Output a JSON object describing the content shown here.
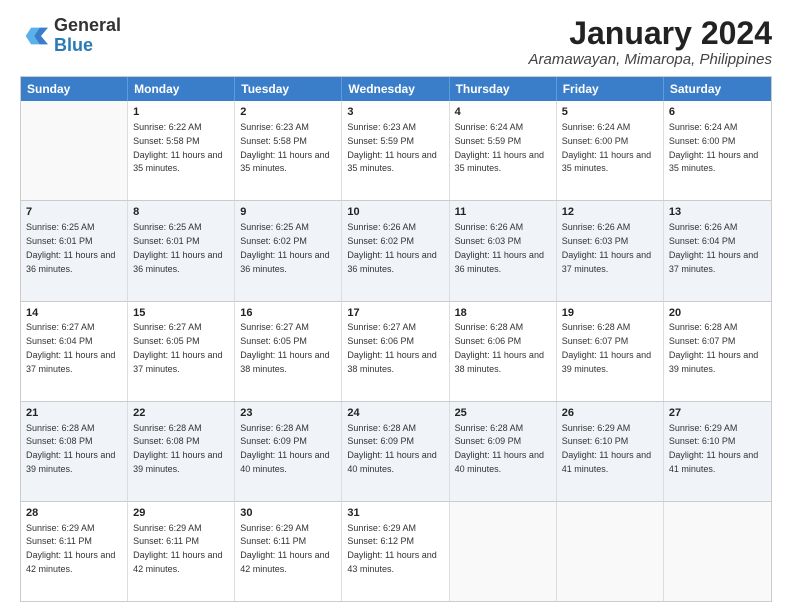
{
  "header": {
    "logo": {
      "general": "General",
      "blue": "Blue"
    },
    "title": "January 2024",
    "subtitle": "Aramawayan, Mimaropa, Philippines"
  },
  "calendar": {
    "days": [
      "Sunday",
      "Monday",
      "Tuesday",
      "Wednesday",
      "Thursday",
      "Friday",
      "Saturday"
    ],
    "weeks": [
      [
        {
          "day": "",
          "empty": true
        },
        {
          "day": "1",
          "sunrise": "Sunrise: 6:22 AM",
          "sunset": "Sunset: 5:58 PM",
          "daylight": "Daylight: 11 hours and 35 minutes."
        },
        {
          "day": "2",
          "sunrise": "Sunrise: 6:23 AM",
          "sunset": "Sunset: 5:58 PM",
          "daylight": "Daylight: 11 hours and 35 minutes."
        },
        {
          "day": "3",
          "sunrise": "Sunrise: 6:23 AM",
          "sunset": "Sunset: 5:59 PM",
          "daylight": "Daylight: 11 hours and 35 minutes."
        },
        {
          "day": "4",
          "sunrise": "Sunrise: 6:24 AM",
          "sunset": "Sunset: 5:59 PM",
          "daylight": "Daylight: 11 hours and 35 minutes."
        },
        {
          "day": "5",
          "sunrise": "Sunrise: 6:24 AM",
          "sunset": "Sunset: 6:00 PM",
          "daylight": "Daylight: 11 hours and 35 minutes."
        },
        {
          "day": "6",
          "sunrise": "Sunrise: 6:24 AM",
          "sunset": "Sunset: 6:00 PM",
          "daylight": "Daylight: 11 hours and 35 minutes."
        }
      ],
      [
        {
          "day": "7",
          "sunrise": "Sunrise: 6:25 AM",
          "sunset": "Sunset: 6:01 PM",
          "daylight": "Daylight: 11 hours and 36 minutes."
        },
        {
          "day": "8",
          "sunrise": "Sunrise: 6:25 AM",
          "sunset": "Sunset: 6:01 PM",
          "daylight": "Daylight: 11 hours and 36 minutes."
        },
        {
          "day": "9",
          "sunrise": "Sunrise: 6:25 AM",
          "sunset": "Sunset: 6:02 PM",
          "daylight": "Daylight: 11 hours and 36 minutes."
        },
        {
          "day": "10",
          "sunrise": "Sunrise: 6:26 AM",
          "sunset": "Sunset: 6:02 PM",
          "daylight": "Daylight: 11 hours and 36 minutes."
        },
        {
          "day": "11",
          "sunrise": "Sunrise: 6:26 AM",
          "sunset": "Sunset: 6:03 PM",
          "daylight": "Daylight: 11 hours and 36 minutes."
        },
        {
          "day": "12",
          "sunrise": "Sunrise: 6:26 AM",
          "sunset": "Sunset: 6:03 PM",
          "daylight": "Daylight: 11 hours and 37 minutes."
        },
        {
          "day": "13",
          "sunrise": "Sunrise: 6:26 AM",
          "sunset": "Sunset: 6:04 PM",
          "daylight": "Daylight: 11 hours and 37 minutes."
        }
      ],
      [
        {
          "day": "14",
          "sunrise": "Sunrise: 6:27 AM",
          "sunset": "Sunset: 6:04 PM",
          "daylight": "Daylight: 11 hours and 37 minutes."
        },
        {
          "day": "15",
          "sunrise": "Sunrise: 6:27 AM",
          "sunset": "Sunset: 6:05 PM",
          "daylight": "Daylight: 11 hours and 37 minutes."
        },
        {
          "day": "16",
          "sunrise": "Sunrise: 6:27 AM",
          "sunset": "Sunset: 6:05 PM",
          "daylight": "Daylight: 11 hours and 38 minutes."
        },
        {
          "day": "17",
          "sunrise": "Sunrise: 6:27 AM",
          "sunset": "Sunset: 6:06 PM",
          "daylight": "Daylight: 11 hours and 38 minutes."
        },
        {
          "day": "18",
          "sunrise": "Sunrise: 6:28 AM",
          "sunset": "Sunset: 6:06 PM",
          "daylight": "Daylight: 11 hours and 38 minutes."
        },
        {
          "day": "19",
          "sunrise": "Sunrise: 6:28 AM",
          "sunset": "Sunset: 6:07 PM",
          "daylight": "Daylight: 11 hours and 39 minutes."
        },
        {
          "day": "20",
          "sunrise": "Sunrise: 6:28 AM",
          "sunset": "Sunset: 6:07 PM",
          "daylight": "Daylight: 11 hours and 39 minutes."
        }
      ],
      [
        {
          "day": "21",
          "sunrise": "Sunrise: 6:28 AM",
          "sunset": "Sunset: 6:08 PM",
          "daylight": "Daylight: 11 hours and 39 minutes."
        },
        {
          "day": "22",
          "sunrise": "Sunrise: 6:28 AM",
          "sunset": "Sunset: 6:08 PM",
          "daylight": "Daylight: 11 hours and 39 minutes."
        },
        {
          "day": "23",
          "sunrise": "Sunrise: 6:28 AM",
          "sunset": "Sunset: 6:09 PM",
          "daylight": "Daylight: 11 hours and 40 minutes."
        },
        {
          "day": "24",
          "sunrise": "Sunrise: 6:28 AM",
          "sunset": "Sunset: 6:09 PM",
          "daylight": "Daylight: 11 hours and 40 minutes."
        },
        {
          "day": "25",
          "sunrise": "Sunrise: 6:28 AM",
          "sunset": "Sunset: 6:09 PM",
          "daylight": "Daylight: 11 hours and 40 minutes."
        },
        {
          "day": "26",
          "sunrise": "Sunrise: 6:29 AM",
          "sunset": "Sunset: 6:10 PM",
          "daylight": "Daylight: 11 hours and 41 minutes."
        },
        {
          "day": "27",
          "sunrise": "Sunrise: 6:29 AM",
          "sunset": "Sunset: 6:10 PM",
          "daylight": "Daylight: 11 hours and 41 minutes."
        }
      ],
      [
        {
          "day": "28",
          "sunrise": "Sunrise: 6:29 AM",
          "sunset": "Sunset: 6:11 PM",
          "daylight": "Daylight: 11 hours and 42 minutes."
        },
        {
          "day": "29",
          "sunrise": "Sunrise: 6:29 AM",
          "sunset": "Sunset: 6:11 PM",
          "daylight": "Daylight: 11 hours and 42 minutes."
        },
        {
          "day": "30",
          "sunrise": "Sunrise: 6:29 AM",
          "sunset": "Sunset: 6:11 PM",
          "daylight": "Daylight: 11 hours and 42 minutes."
        },
        {
          "day": "31",
          "sunrise": "Sunrise: 6:29 AM",
          "sunset": "Sunset: 6:12 PM",
          "daylight": "Daylight: 11 hours and 43 minutes."
        },
        {
          "day": "",
          "empty": true
        },
        {
          "day": "",
          "empty": true
        },
        {
          "day": "",
          "empty": true
        }
      ]
    ]
  }
}
